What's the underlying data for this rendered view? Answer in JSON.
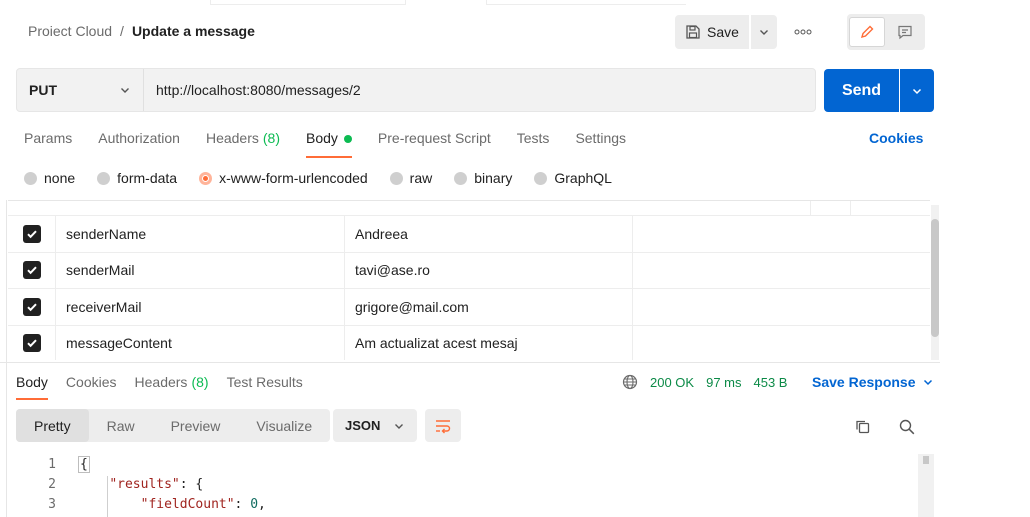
{
  "breadcrumb": {
    "parent": "Proiect Cloud",
    "separator": "/",
    "current": "Update a message"
  },
  "header": {
    "save_label": "Save"
  },
  "request": {
    "method": "PUT",
    "url": "http://localhost:8080/messages/2",
    "send_label": "Send"
  },
  "request_tabs": [
    {
      "label": "Params"
    },
    {
      "label": "Authorization"
    },
    {
      "label": "Headers",
      "count": "(8)"
    },
    {
      "label": "Body"
    },
    {
      "label": "Pre-request Script"
    },
    {
      "label": "Tests"
    },
    {
      "label": "Settings"
    }
  ],
  "cookies_label": "Cookies",
  "body_types": [
    {
      "label": "none"
    },
    {
      "label": "form-data"
    },
    {
      "label": "x-www-form-urlencoded"
    },
    {
      "label": "raw"
    },
    {
      "label": "binary"
    },
    {
      "label": "GraphQL"
    }
  ],
  "params": [
    {
      "key": "senderName",
      "value": "Andreea"
    },
    {
      "key": "senderMail",
      "value": "tavi@ase.ro"
    },
    {
      "key": "receiverMail",
      "value": "grigore@mail.com"
    },
    {
      "key": "messageContent",
      "value": "Am actualizat acest mesaj"
    }
  ],
  "response_tabs": [
    {
      "label": "Body"
    },
    {
      "label": "Cookies"
    },
    {
      "label": "Headers",
      "count": "(8)"
    },
    {
      "label": "Test Results"
    }
  ],
  "response_meta": {
    "status": "200 OK",
    "time": "97 ms",
    "size": "453 B",
    "save_label": "Save Response"
  },
  "format_options": [
    {
      "label": "Pretty"
    },
    {
      "label": "Raw"
    },
    {
      "label": "Preview"
    },
    {
      "label": "Visualize"
    }
  ],
  "language": "JSON",
  "code_lines": [
    {
      "no": "1",
      "text": "{"
    },
    {
      "no": "2",
      "key": "\"results\"",
      "rest": ": {"
    },
    {
      "no": "3",
      "key": "\"fieldCount\"",
      "rest": ": ",
      "num": "0",
      "tail": ","
    }
  ],
  "colors": {
    "accent": "#ff6c37",
    "primary": "#0265d2",
    "success": "#0cbb52"
  }
}
